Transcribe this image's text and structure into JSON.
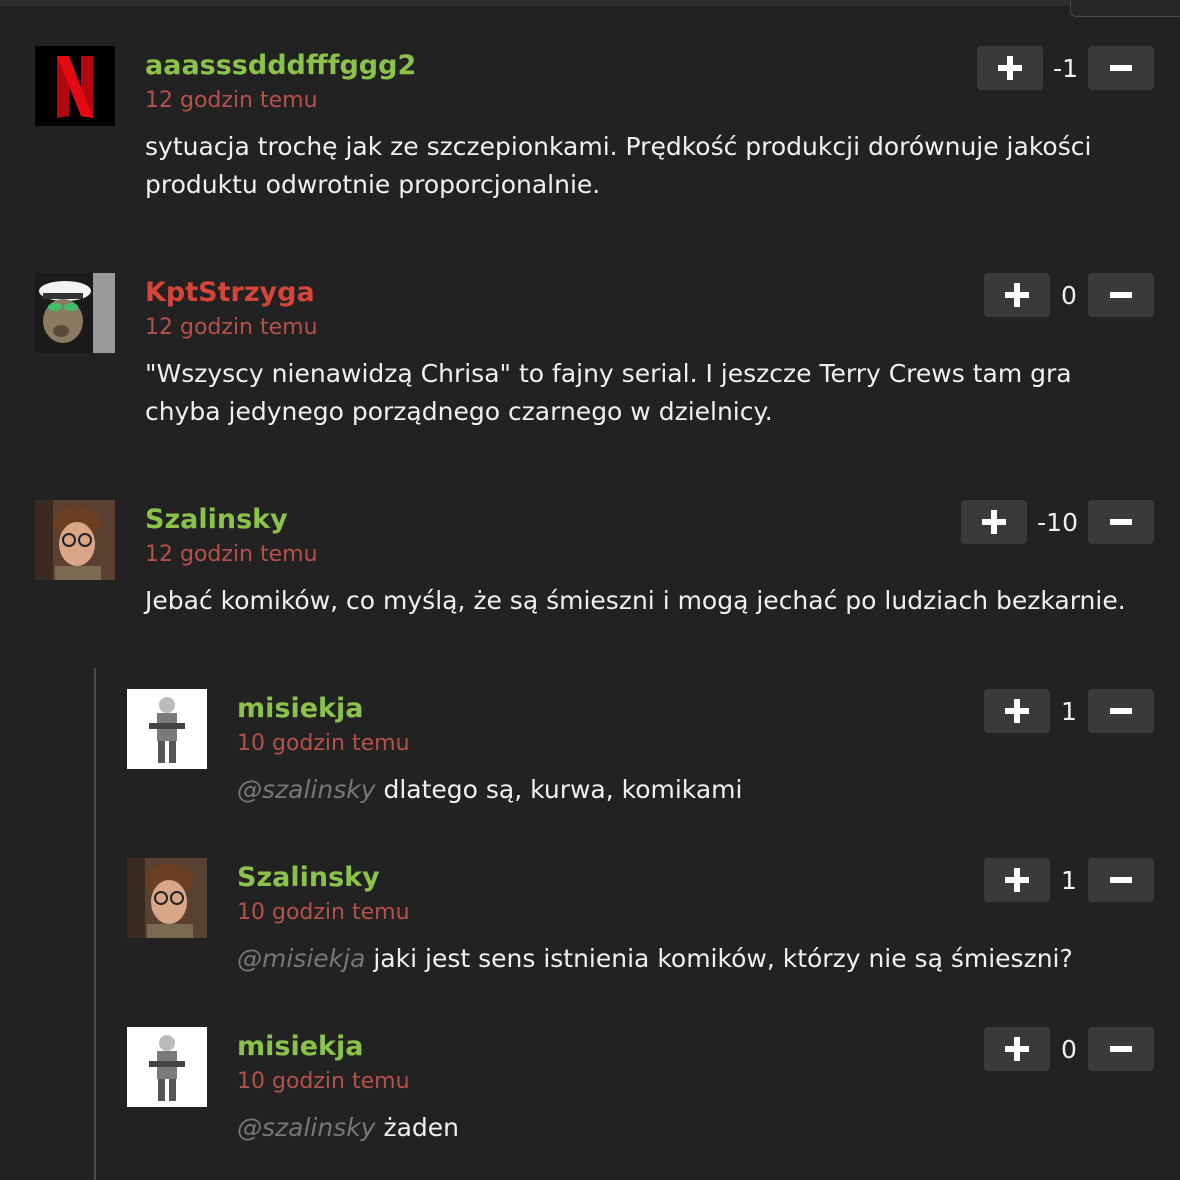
{
  "comments": [
    {
      "username": "aaasssdddfffggg2",
      "time": "12 godzin temu",
      "text": "sytuacja trochę jak ze szczepionkami. Prędkość produkcji dorównuje jakości produktu odwrotnie proporcjonalnie.",
      "score": "-1",
      "name_color": "#8bc34a",
      "avatar": "netflix-logo-avatar"
    },
    {
      "username": "KptStrzyga",
      "time": "12 godzin temu",
      "text": "\"Wszyscy nienawidzą Chrisa\" to fajny serial. I jeszcze Terry Crews tam gra chyba jedynego porządnego czarnego w dzielnicy.",
      "score": "0",
      "name_color": "#d6453a",
      "avatar": "captain-avatar"
    },
    {
      "username": "Szalinsky",
      "time": "12 godzin temu",
      "text": "Jebać komików, co myślą, że są śmieszni i mogą jechać po ludziach bezkarnie.",
      "score": "-10",
      "name_color": "#8bc34a",
      "avatar": "man-glasses-avatar"
    }
  ],
  "replies": [
    {
      "username": "misiekja",
      "time": "10 godzin temu",
      "mention": "@szalinsky",
      "text": "dlatego są, kurwa, komikami",
      "score": "1",
      "avatar": "figure-avatar"
    },
    {
      "username": "Szalinsky",
      "time": "10 godzin temu",
      "mention": "@misiekja",
      "text": "jaki jest sens istnienia komików, którzy nie są śmieszni?",
      "score": "1",
      "avatar": "man-glasses-avatar"
    },
    {
      "username": "misiekja",
      "time": "10 godzin temu",
      "mention": "@szalinsky",
      "text": "żaden",
      "score": "0",
      "avatar": "figure-avatar"
    }
  ],
  "colors": {
    "background": "#222222",
    "username_green": "#8bc34a",
    "username_red": "#d6453a",
    "timestamp": "#b5514a",
    "button": "#3a3a3a"
  },
  "icons": {
    "upvote": "plus-icon",
    "downvote": "minus-icon"
  }
}
